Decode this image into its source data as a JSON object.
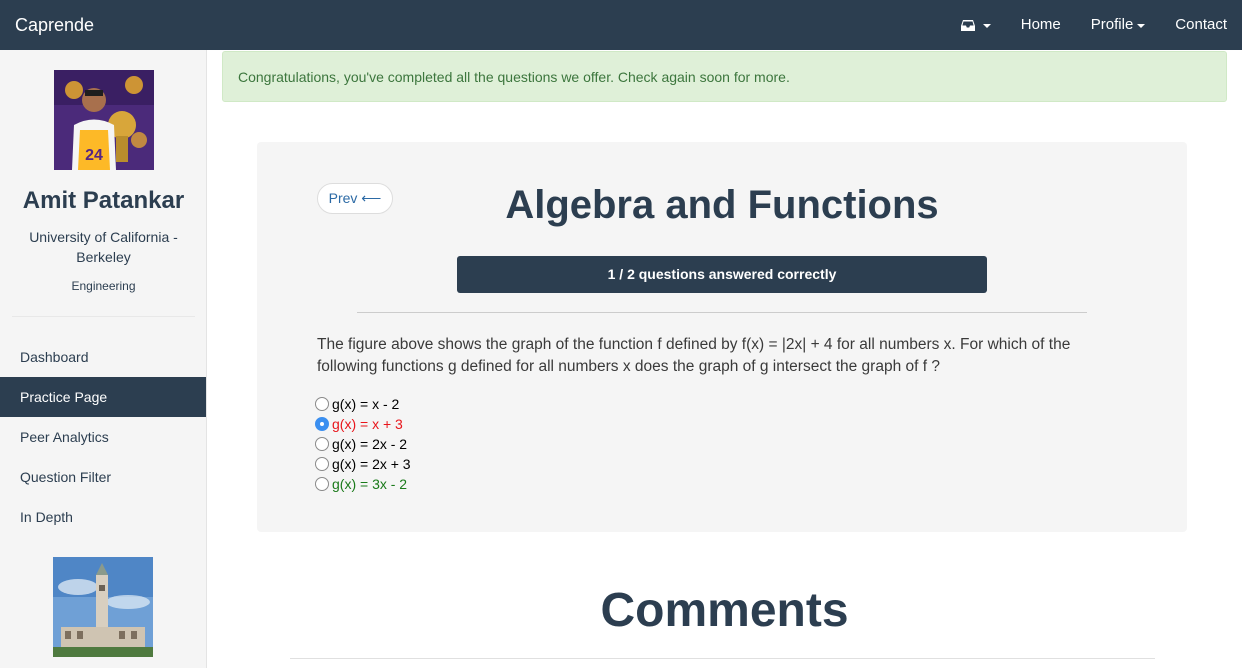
{
  "navbar": {
    "brand": "Caprende",
    "inbox_icon": "inbox-icon",
    "links": [
      {
        "label": "Home",
        "dropdown": false
      },
      {
        "label": "Profile",
        "dropdown": true
      },
      {
        "label": "Contact",
        "dropdown": false
      }
    ],
    "color": "#2c3e50"
  },
  "sidebar": {
    "user_name": "Amit Patankar",
    "school": "University of California - Berkeley",
    "major": "Engineering",
    "items": [
      {
        "label": "Dashboard",
        "active": false
      },
      {
        "label": "Practice Page",
        "active": true
      },
      {
        "label": "Peer Analytics",
        "active": false
      },
      {
        "label": "Question Filter",
        "active": false
      },
      {
        "label": "In Depth",
        "active": false
      }
    ]
  },
  "alert": {
    "text": "Congratulations, you've completed all the questions we offer. Check again soon for more."
  },
  "practice": {
    "prev_label": "Prev ⟵",
    "title": "Algebra and Functions",
    "progress_text": "1 / 2 questions answered correctly",
    "question": "The figure above shows the graph of the function f defined by f(x) = |2x| + 4 for all numbers x. For which of the following functions g defined for all numbers x does the graph of g intersect the graph of f ?",
    "choices": [
      {
        "label": "g(x) = x - 2",
        "checked": false,
        "color": "#000000"
      },
      {
        "label": "g(x) = x + 3",
        "checked": true,
        "color": "#e8151b"
      },
      {
        "label": "g(x) = 2x - 2",
        "checked": false,
        "color": "#000000"
      },
      {
        "label": "g(x) = 2x + 3",
        "checked": false,
        "color": "#000000"
      },
      {
        "label": "g(x) = 3x - 2",
        "checked": false,
        "color": "#1a7a1a"
      }
    ]
  },
  "comments": {
    "title": "Comments"
  }
}
